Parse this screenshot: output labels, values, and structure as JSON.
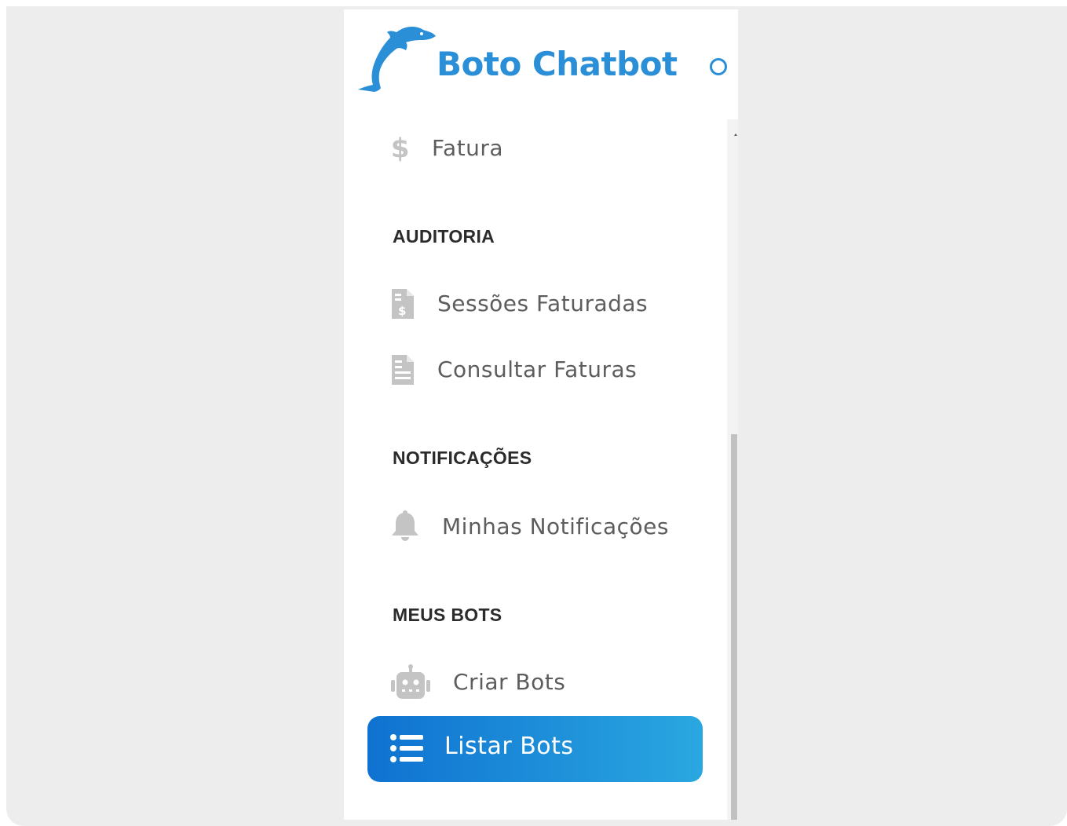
{
  "app": {
    "title": "Boto Chatbot"
  },
  "menu": {
    "top_item": {
      "label": "Fatura",
      "icon": "dollar-icon"
    },
    "sections": [
      {
        "heading": "AUDITORIA",
        "items": [
          {
            "label": "Sessões Faturadas",
            "icon": "invoice-dollar-icon"
          },
          {
            "label": "Consultar Faturas",
            "icon": "document-list-icon"
          }
        ]
      },
      {
        "heading": "NOTIFICAÇÕES",
        "items": [
          {
            "label": "Minhas Notificações",
            "icon": "bell-icon"
          }
        ]
      },
      {
        "heading": "MEUS BOTS",
        "items": [
          {
            "label": "Criar Bots",
            "icon": "robot-icon"
          },
          {
            "label": "Listar Bots",
            "icon": "list-icon",
            "active": true
          }
        ]
      }
    ]
  },
  "colors": {
    "brand": "#2a8fd6",
    "active_gradient_start": "#0f72d1",
    "active_gradient_end": "#2aa7e0",
    "icon_gray": "#c4c4c4",
    "text_gray": "#5d5d5d"
  }
}
